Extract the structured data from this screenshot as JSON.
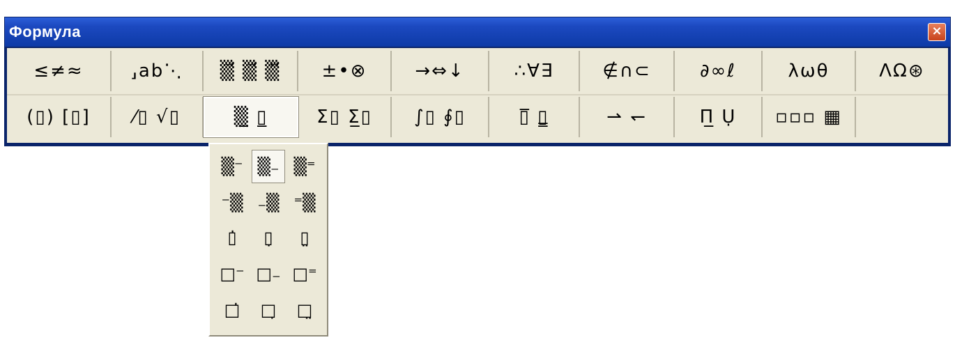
{
  "window": {
    "title": "Формула",
    "close_label": "×"
  },
  "toolbar": {
    "row1": [
      {
        "label": "≤≠≈"
      },
      {
        "label": "⸥ab⋱"
      },
      {
        "label": "▒⃗ ▒⃗ ▒⃡"
      },
      {
        "label": "±•⊗"
      },
      {
        "label": "→⇔↓"
      },
      {
        "label": "∴∀∃"
      },
      {
        "label": "∉∩⊂"
      },
      {
        "label": "∂∞ℓ"
      },
      {
        "label": "λωθ"
      },
      {
        "label": "ΛΩ⊛"
      }
    ],
    "row2": [
      {
        "label": "(▯) [▯]"
      },
      {
        "label": "⁄▯ √▯"
      },
      {
        "label": "▒̲ ▯̲"
      },
      {
        "label": "Σ▯ Σ̲▯"
      },
      {
        "label": "∫▯ ∮▯"
      },
      {
        "label": "▯̅ ▯̳"
      },
      {
        "label": "⇀ ↽"
      },
      {
        "label": "Π̲ Ụ"
      },
      {
        "label": "▫▫▫ ▦"
      },
      {
        "label": ""
      }
    ]
  },
  "dropdown": {
    "items": [
      {
        "label": "▒⁻"
      },
      {
        "label": "▒₋"
      },
      {
        "label": "▒⁼"
      },
      {
        "label": "⁻▒"
      },
      {
        "label": "₋▒"
      },
      {
        "label": "⁼▒"
      },
      {
        "label": "▯̇"
      },
      {
        "label": "▯̣"
      },
      {
        "label": "▯̤"
      },
      {
        "label": "□⁻"
      },
      {
        "label": "□₋"
      },
      {
        "label": "□⁼"
      },
      {
        "label": "□̇"
      },
      {
        "label": "□̣"
      },
      {
        "label": "□̤"
      }
    ]
  }
}
